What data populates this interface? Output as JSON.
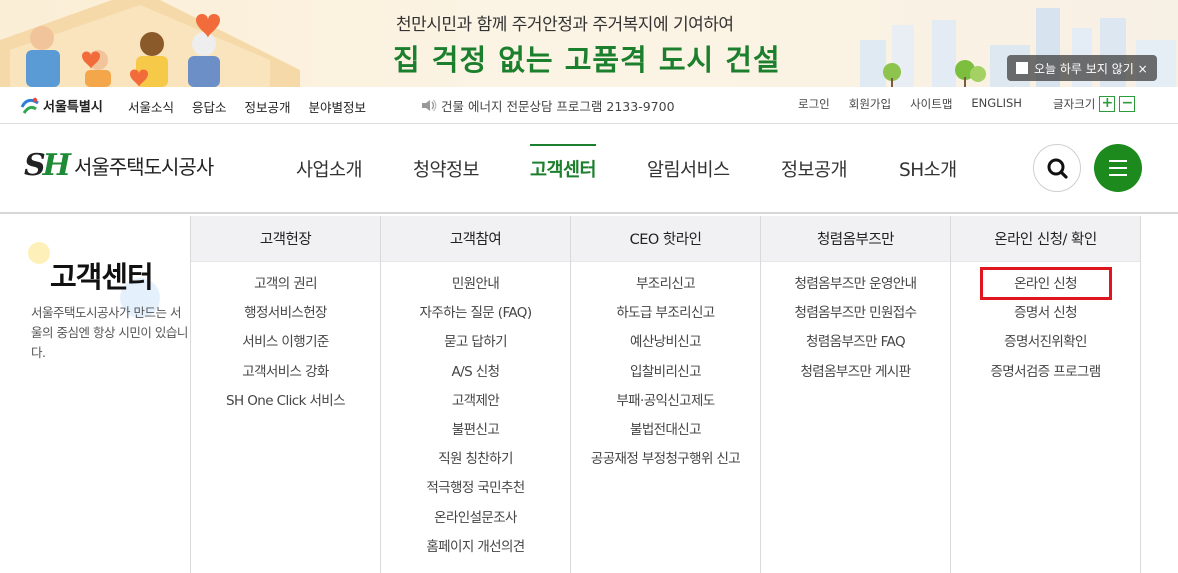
{
  "banner": {
    "line1": "천만시민과 함께 주거안정과 주거복지에 기여하여",
    "line2": "집 걱정 없는 고품격 도시 건설",
    "close_today": "오늘 하루 보지 않기 ×"
  },
  "utility": {
    "seoul_logo": "서울특별시",
    "links_left": [
      "서울소식",
      "응답소",
      "정보공개",
      "분야별정보"
    ],
    "notice": "건물 에너지 전문상담 프로그램 2133-9700",
    "links_right": [
      "로그인",
      "회원가입",
      "사이트맵",
      "ENGLISH"
    ],
    "font_size_label": "글자크기",
    "font_plus": "+",
    "font_minus": "−"
  },
  "header": {
    "logo_mark_s": "S",
    "logo_mark_h": "H",
    "logo_name": "서울주택도시공사",
    "menu": [
      "사업소개",
      "청약정보",
      "고객센터",
      "알림서비스",
      "정보공개",
      "SH소개"
    ],
    "active_menu": "고객센터"
  },
  "intro": {
    "title": "고객센터",
    "description": "서울주택도시공사가 만드는 서울의 중심엔 항상 시민이 있습니다."
  },
  "mega_menu": {
    "columns": [
      {
        "heading": "고객헌장",
        "items": [
          "고객의 권리",
          "행정서비스헌장",
          "서비스 이행기준",
          "고객서비스 강화",
          "SH One Click 서비스"
        ]
      },
      {
        "heading": "고객참여",
        "items": [
          "민원안내",
          "자주하는 질문 (FAQ)",
          "묻고 답하기",
          "A/S 신청",
          "고객제안",
          "불편신고",
          "직원 칭찬하기",
          "적극행정 국민추천",
          "온라인설문조사",
          "홈페이지 개선의견"
        ]
      },
      {
        "heading": "CEO 핫라인",
        "items": [
          "부조리신고",
          "하도급 부조리신고",
          "예산낭비신고",
          "입찰비리신고",
          "부패·공익신고제도",
          "불법전대신고",
          "공공재정 부정청구행위 신고"
        ]
      },
      {
        "heading": "청렴옴부즈만",
        "items": [
          "청렴옴부즈만 운영안내",
          "청렴옴부즈만 민원접수",
          "청렴옴부즈만 FAQ",
          "청렴옴부즈만 게시판"
        ]
      },
      {
        "heading": "온라인 신청/ 확인",
        "items": [
          "온라인 신청",
          "증명서 신청",
          "증명서진위확인",
          "증명서검증 프로그램"
        ]
      }
    ],
    "highlighted_item": "온라인 신청"
  },
  "colors": {
    "brand_green": "#1c7f2d",
    "menu_button": "#1c8a1c",
    "highlight_box": "#e0161e"
  }
}
